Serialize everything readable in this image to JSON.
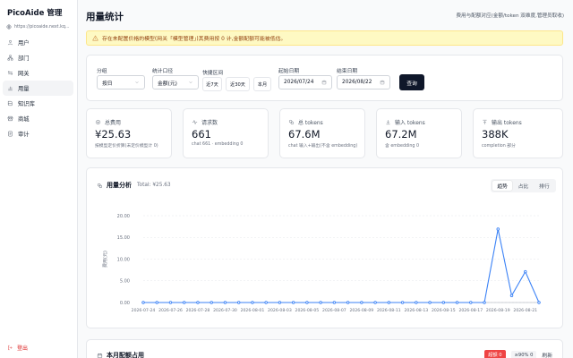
{
  "app": {
    "title": "PicoAide 管理",
    "url": "https://picoaide.next.kq..."
  },
  "sidebar": {
    "items": [
      {
        "label": "用户",
        "icon": "user-icon"
      },
      {
        "label": "部门",
        "icon": "department-icon"
      },
      {
        "label": "网关",
        "icon": "gateway-icon"
      },
      {
        "label": "用量",
        "icon": "usage-icon"
      },
      {
        "label": "知识库",
        "icon": "book-icon"
      },
      {
        "label": "商城",
        "icon": "store-icon"
      },
      {
        "label": "审计",
        "icon": "audit-icon"
      }
    ],
    "logout": "登出"
  },
  "header": {
    "title": "用量统计",
    "description": "费用与配额对应(金额/token 双维度,管理员取收)"
  },
  "warning": {
    "text": "存在未配置价格的模型(网关「模型管理」)其费用按 0 计,金额配额可能被低估。"
  },
  "filters": {
    "group_label": "分组",
    "group_value": "按日",
    "metric_label": "统计口径",
    "metric_value": "金额(元)",
    "range_label": "快捷区间",
    "range_buttons": [
      "近7天",
      "近30天",
      "本月"
    ],
    "start_label": "起始日期",
    "start_value": "2026/07/24",
    "end_label": "结束日期",
    "end_value": "2026/08/22",
    "query_button": "查询"
  },
  "stats": [
    {
      "label": "总费用",
      "value": "¥25.63",
      "sub": "按模型定价折算(未定价模型计 0)",
      "icon": "coin-icon"
    },
    {
      "label": "请求数",
      "value": "661",
      "sub": "chat 661 · embedding 0",
      "icon": "activity-icon"
    },
    {
      "label": "总 tokens",
      "value": "67.6M",
      "sub": "chat 输入+输出(不含 embedding)",
      "icon": "token-icon"
    },
    {
      "label": "输入 tokens",
      "value": "67.2M",
      "sub": "含 embedding 0",
      "icon": "download-icon"
    },
    {
      "label": "输出 tokens",
      "value": "388K",
      "sub": "completion 部分",
      "icon": "upload-icon"
    }
  ],
  "analysis": {
    "title": "用量分析",
    "total": "Total: ¥25.63",
    "tabs": [
      "趋势",
      "占比",
      "排行"
    ],
    "active_tab": "趋势"
  },
  "chart_data": {
    "type": "line",
    "ylabel": "费用(元)",
    "ylim": [
      0,
      20
    ],
    "yticks": [
      "0.00",
      "5.00",
      "10.00",
      "15.00",
      "20.00"
    ],
    "x": [
      "2026-07-24",
      "2026-07-25",
      "2026-07-26",
      "2026-07-27",
      "2026-07-28",
      "2026-07-29",
      "2026-07-30",
      "2026-07-31",
      "2026-08-01",
      "2026-08-02",
      "2026-08-03",
      "2026-08-04",
      "2026-08-05",
      "2026-08-06",
      "2026-08-07",
      "2026-08-08",
      "2026-08-09",
      "2026-08-10",
      "2026-08-11",
      "2026-08-12",
      "2026-08-13",
      "2026-08-14",
      "2026-08-15",
      "2026-08-16",
      "2026-08-17",
      "2026-08-18",
      "2026-08-19",
      "2026-08-20",
      "2026-08-21",
      "2026-08-22"
    ],
    "xtick_labels": [
      "2026-07-24",
      "2026-07-26",
      "2026-07-28",
      "2026-07-30",
      "2026-08-01",
      "2026-08-03",
      "2026-08-05",
      "2026-08-07",
      "2026-08-09",
      "2026-08-11",
      "2026-08-13",
      "2026-08-15",
      "2026-08-17",
      "2026-08-19",
      "2026-08-21"
    ],
    "values": [
      0,
      0,
      0,
      0,
      0,
      0,
      0,
      0,
      0,
      0,
      0,
      0,
      0,
      0,
      0,
      0,
      0,
      0,
      0,
      0,
      0,
      0,
      0,
      0,
      0,
      0,
      16.9,
      1.6,
      7.1,
      0
    ],
    "color": "#3b82f6"
  },
  "monthly": {
    "title": "本月配额占用",
    "badge_red": "超额 0",
    "badge_gray": "≥90% 0",
    "refresh": "刷新"
  }
}
